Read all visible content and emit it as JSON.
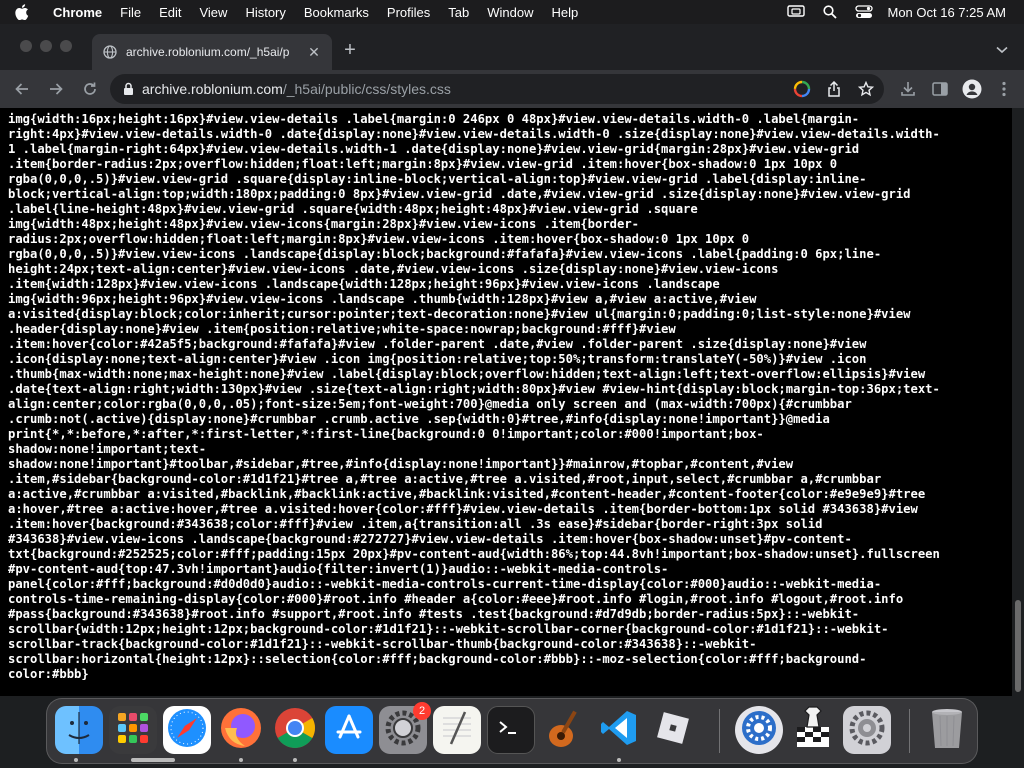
{
  "menubar": {
    "app_name": "Chrome",
    "items": [
      "File",
      "Edit",
      "View",
      "History",
      "Bookmarks",
      "Profiles",
      "Tab",
      "Window",
      "Help"
    ],
    "clock": "Mon Oct 16  7:25 AM"
  },
  "tab": {
    "title": "archive.roblonium.com/_h5ai/p"
  },
  "omnibox": {
    "host": "archive.roblonium.com",
    "path": "/_h5ai/public/css/styles.css"
  },
  "code_lines": [
    "img{width:16px;height:16px}#view.view-details .label{margin:0 246px 0 48px}#view.view-details.width-0 .label{margin-",
    "right:4px}#view.view-details.width-0 .date{display:none}#view.view-details.width-0 .size{display:none}#view.view-details.width-",
    "1 .label{margin-right:64px}#view.view-details.width-1 .date{display:none}#view.view-grid{margin:28px}#view.view-grid",
    ".item{border-radius:2px;overflow:hidden;float:left;margin:8px}#view.view-grid .item:hover{box-shadow:0 1px 10px 0",
    "rgba(0,0,0,.5)}#view.view-grid .square{display:inline-block;vertical-align:top}#view.view-grid .label{display:inline-",
    "block;vertical-align:top;width:180px;padding:0 8px}#view.view-grid .date,#view.view-grid .size{display:none}#view.view-grid",
    ".label{line-height:48px}#view.view-grid .square{width:48px;height:48px}#view.view-grid .square",
    "img{width:48px;height:48px}#view.view-icons{margin:28px}#view.view-icons .item{border-",
    "radius:2px;overflow:hidden;float:left;margin:8px}#view.view-icons .item:hover{box-shadow:0 1px 10px 0",
    "rgba(0,0,0,.5)}#view.view-icons .landscape{display:block;background:#fafafa}#view.view-icons .label{padding:0 6px;line-",
    "height:24px;text-align:center}#view.view-icons .date,#view.view-icons .size{display:none}#view.view-icons",
    ".item{width:128px}#view.view-icons .landscape{width:128px;height:96px}#view.view-icons .landscape",
    "img{width:96px;height:96px}#view.view-icons .landscape .thumb{width:128px}#view a,#view a:active,#view",
    "a:visited{display:block;color:inherit;cursor:pointer;text-decoration:none}#view ul{margin:0;padding:0;list-style:none}#view",
    ".header{display:none}#view .item{position:relative;white-space:nowrap;background:#fff}#view",
    ".item:hover{color:#42a5f5;background:#fafafa}#view .folder-parent .date,#view .folder-parent .size{display:none}#view",
    ".icon{display:none;text-align:center}#view .icon img{position:relative;top:50%;transform:translateY(-50%)}#view .icon",
    ".thumb{max-width:none;max-height:none}#view .label{display:block;overflow:hidden;text-align:left;text-overflow:ellipsis}#view",
    ".date{text-align:right;width:130px}#view .size{text-align:right;width:80px}#view #view-hint{display:block;margin-top:36px;text-",
    "align:center;color:rgba(0,0,0,.05);font-size:5em;font-weight:700}@media only screen and (max-width:700px){#crumbbar",
    ".crumb:not(.active){display:none}#crumbbar .crumb.active .sep{width:0}#tree,#info{display:none!important}}@media",
    "print{*,*:before,*:after,*:first-letter,*:first-line{background:0 0!important;color:#000!important;box-",
    "shadow:none!important;text-",
    "shadow:none!important}#toolbar,#sidebar,#tree,#info{display:none!important}}#mainrow,#topbar,#content,#view",
    ".item,#sidebar{background-color:#1d1f21}#tree a,#tree a:active,#tree a.visited,#root,input,select,#crumbbar a,#crumbbar",
    "a:active,#crumbbar a:visited,#backlink,#backlink:active,#backlink:visited,#content-header,#content-footer{color:#e9e9e9}#tree",
    "a:hover,#tree a:active:hover,#tree a.visited:hover{color:#fff}#view.view-details .item{border-bottom:1px solid #343638}#view",
    ".item:hover{background:#343638;color:#fff}#view .item,a{transition:all .3s ease}#sidebar{border-right:3px solid",
    "#343638}#view.view-icons .landscape{background:#272727}#view.view-details .item:hover{box-shadow:unset}#pv-content-",
    "txt{background:#252525;color:#fff;padding:15px 20px}#pv-content-aud{width:86%;top:44.8vh!important;box-shadow:unset}.fullscreen",
    "#pv-content-aud{top:47.3vh!important}audio{filter:invert(1)}audio::-webkit-media-controls-",
    "panel{color:#fff;background:#d0d0d0}audio::-webkit-media-controls-current-time-display{color:#000}audio::-webkit-media-",
    "controls-time-remaining-display{color:#000}#root.info #header a{color:#eee}#root.info #login,#root.info #logout,#root.info",
    "#pass{background:#343638}#root.info #support,#root.info #tests .test{background:#d7d9db;border-radius:5px}::-webkit-",
    "scrollbar{width:12px;height:12px;background-color:#1d1f21}::-webkit-scrollbar-corner{background-color:#1d1f21}::-webkit-",
    "scrollbar-track{background-color:#1d1f21}::-webkit-scrollbar-thumb{background-color:#343638}::-webkit-",
    "scrollbar:horizontal{height:12px}::selection{color:#fff;background-color:#bbb}::-moz-selection{color:#fff;background-",
    "color:#bbb}"
  ],
  "dock": {
    "apps": [
      {
        "name": "Finder",
        "icon": "finder-icon"
      },
      {
        "name": "Launchpad",
        "icon": "launchpad-icon"
      },
      {
        "name": "Safari",
        "icon": "safari-icon"
      },
      {
        "name": "Firefox",
        "icon": "firefox-icon"
      },
      {
        "name": "Chrome",
        "icon": "chrome-icon"
      },
      {
        "name": "App Store",
        "icon": "app-store-icon"
      },
      {
        "name": "System Preferences",
        "icon": "system-preferences-icon",
        "badge": "2"
      },
      {
        "name": "TextEdit",
        "icon": "textedit-icon"
      },
      {
        "name": "Terminal",
        "icon": "terminal-icon"
      },
      {
        "name": "GarageBand",
        "icon": "garageband-icon"
      },
      {
        "name": "Visual Studio Code",
        "icon": "vscode-icon"
      },
      {
        "name": "Roblox",
        "icon": "roblox-icon"
      },
      {
        "name": "Utility",
        "icon": "utility-gear-icon"
      },
      {
        "name": "Chess",
        "icon": "chess-icon"
      },
      {
        "name": "System Settings",
        "icon": "settings-gear-icon"
      },
      {
        "name": "Trash",
        "icon": "trash-icon"
      }
    ]
  },
  "colors": {
    "page_bg": "#000000",
    "code_text": "#ffffff",
    "chrome_frame": "#202124",
    "chrome_toolbar": "#35363a"
  }
}
